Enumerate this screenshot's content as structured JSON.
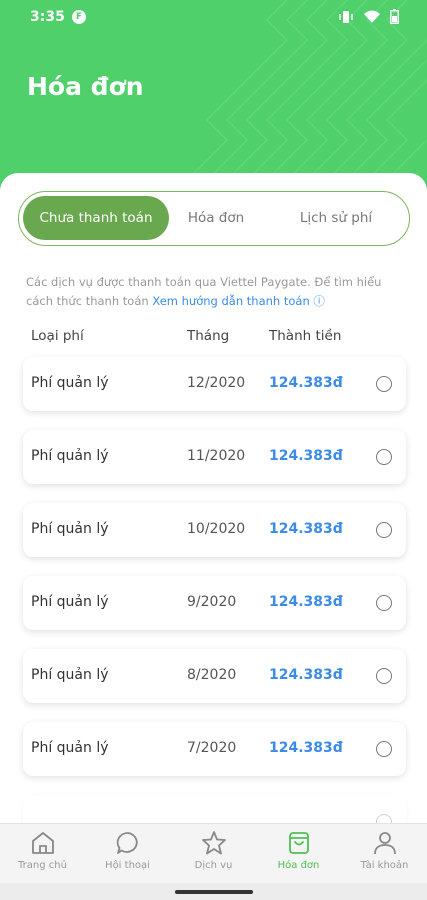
{
  "status_bar": {
    "time": "3:35",
    "app_icon": "F"
  },
  "page": {
    "title": "Hóa đơn"
  },
  "tabs": [
    {
      "label": "Chưa thanh toán",
      "active": true
    },
    {
      "label": "Hóa đơn",
      "active": false
    },
    {
      "label": "Lịch sử phí",
      "active": false
    }
  ],
  "note": {
    "text": "Các dịch vụ được thanh toán qua Viettel Paygate. Để tìm hiểu cách thức thanh toán ",
    "link": "Xem hướng dẫn thanh toán ⓘ"
  },
  "table": {
    "headers": {
      "type": "Loại phí",
      "month": "Tháng",
      "amount": "Thành tiền"
    },
    "rows": [
      {
        "type": "Phí quản lý",
        "month": "12/2020",
        "amount": "124.383đ"
      },
      {
        "type": "Phí quản lý",
        "month": "11/2020",
        "amount": "124.383đ"
      },
      {
        "type": "Phí quản lý",
        "month": "10/2020",
        "amount": "124.383đ"
      },
      {
        "type": "Phí quản lý",
        "month": "9/2020",
        "amount": "124.383đ"
      },
      {
        "type": "Phí quản lý",
        "month": "8/2020",
        "amount": "124.383đ"
      },
      {
        "type": "Phí quản lý",
        "month": "7/2020",
        "amount": "124.383đ"
      }
    ]
  },
  "bottom_nav": [
    {
      "label": "Trang chủ",
      "icon": "home-icon",
      "active": false
    },
    {
      "label": "Hội thoại",
      "icon": "chat-icon",
      "active": false
    },
    {
      "label": "Dịch vụ",
      "icon": "star-icon",
      "active": false
    },
    {
      "label": "Hóa đơn",
      "icon": "bill-icon",
      "active": true
    },
    {
      "label": "Tài khoản",
      "icon": "user-icon",
      "active": false
    }
  ],
  "colors": {
    "header": "#4fd06a",
    "tab_active": "#6aa84f",
    "amount": "#3b8be8",
    "nav_active": "#4fbf55"
  }
}
